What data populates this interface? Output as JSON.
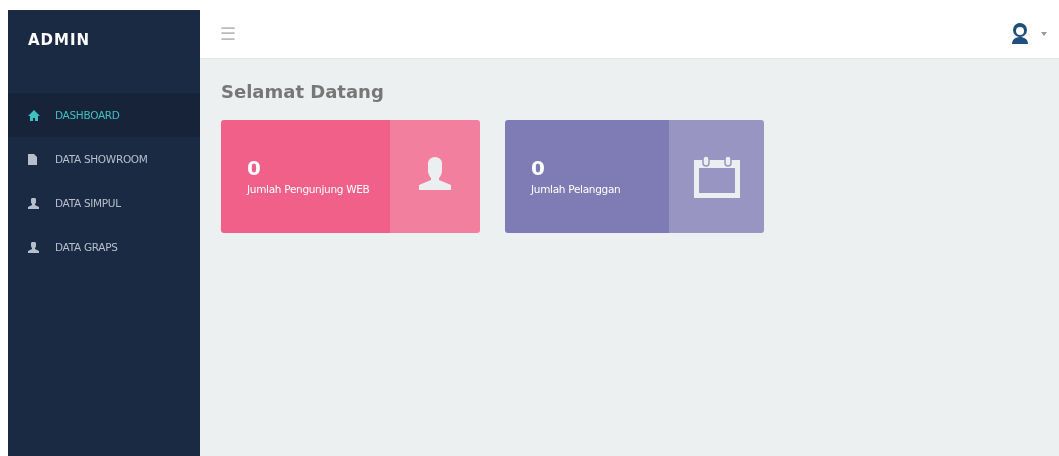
{
  "sidebar": {
    "brand": "ADMIN",
    "items": [
      {
        "label": "DASHBOARD",
        "kind": "home",
        "selected": true
      },
      {
        "label": "DATA SHOWROOM",
        "kind": "file",
        "selected": false
      },
      {
        "label": "DATA SIMPUL",
        "kind": "user",
        "selected": false
      },
      {
        "label": "DATA GRAPS",
        "kind": "user",
        "selected": false
      }
    ]
  },
  "topbar": {
    "menu_icon": "☰"
  },
  "page_title": "Selamat Datang",
  "cards": [
    {
      "value": "0",
      "label": "Jumlah Pengunjung WEB",
      "kind": "user",
      "color": "#f06088"
    },
    {
      "value": "0",
      "label": "Jumlah Pelanggan",
      "kind": "calendar",
      "color": "#7f7bb4"
    }
  ]
}
